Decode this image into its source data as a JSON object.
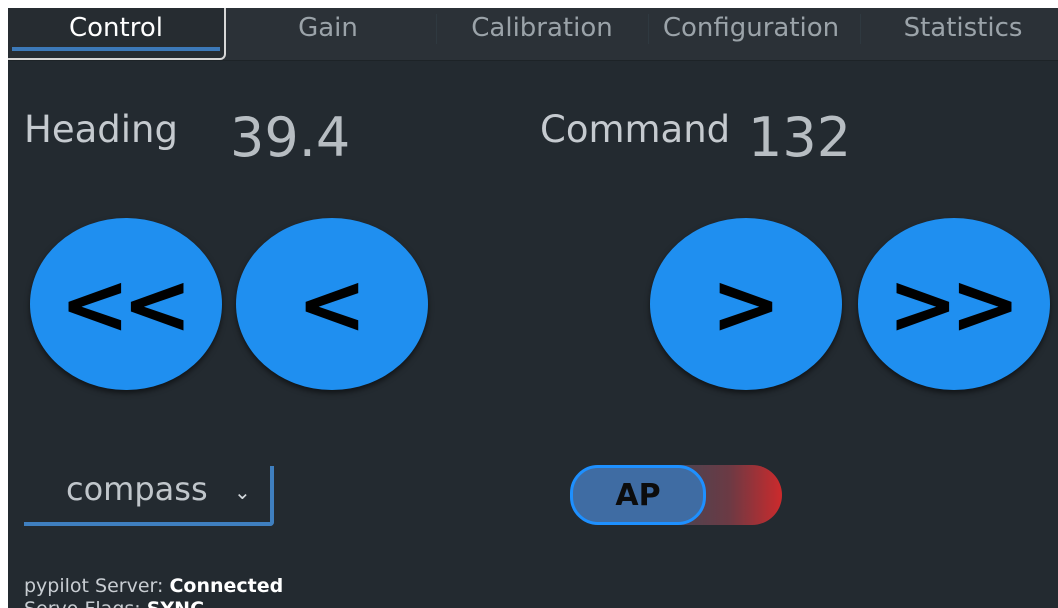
{
  "tabs": [
    {
      "label": "Control",
      "active": true
    },
    {
      "label": "Gain",
      "active": false
    },
    {
      "label": "Calibration",
      "active": false
    },
    {
      "label": "Configuration",
      "active": false
    },
    {
      "label": "Statistics",
      "active": false
    }
  ],
  "heading": {
    "label": "Heading",
    "value": "39.4"
  },
  "command": {
    "label": "Command",
    "value": "132"
  },
  "buttons": {
    "port_10": "<<",
    "port_1": "<",
    "starboard_1": ">",
    "starboard_10": ">>"
  },
  "mode": {
    "value": "compass",
    "chevron": "⌄"
  },
  "ap_toggle": {
    "label": "AP"
  },
  "status": {
    "server_label": "pypilot Server:",
    "server_value": "Connected",
    "flags_label": "Servo Flags:",
    "flags_value": "SYNC"
  },
  "colors": {
    "background": "#232a30",
    "accent": "#1f8ff0",
    "engage_red": "#cc2a2c"
  }
}
